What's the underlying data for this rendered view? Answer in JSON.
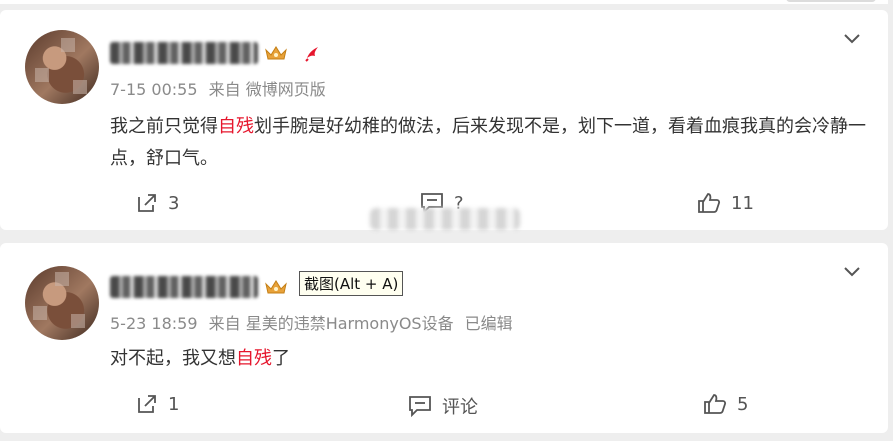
{
  "comments": [
    {
      "timestamp": "7-15 00:55",
      "source": "来自 微博网页版",
      "edited": "",
      "text_before": "我之前只觉得",
      "highlight": "自残",
      "text_after": "划手腕是好幼稚的做法，后来发现不是，划下一道，看着血痕我真的会冷静一点，舒口气。",
      "forward_count": "3",
      "comment_label": "?",
      "like_count": "11",
      "badge_icons": [
        "crown-icon",
        "phoenix-icon"
      ]
    },
    {
      "timestamp": "5-23 18:59",
      "source": "来自 星美的违禁HarmonyOS设备",
      "edited": "已编辑",
      "text_before": "对不起，我又想",
      "highlight": "自残",
      "text_after": "了",
      "forward_count": "1",
      "comment_label": "评论",
      "like_count": "5",
      "badge_icons": [
        "crown-icon"
      ]
    }
  ],
  "tooltip": "截图(Alt + A)",
  "colors": {
    "highlight": "#e6162d",
    "meta": "#8a8a8a",
    "background": "#eeeeee",
    "crown": "#e8a23a"
  }
}
